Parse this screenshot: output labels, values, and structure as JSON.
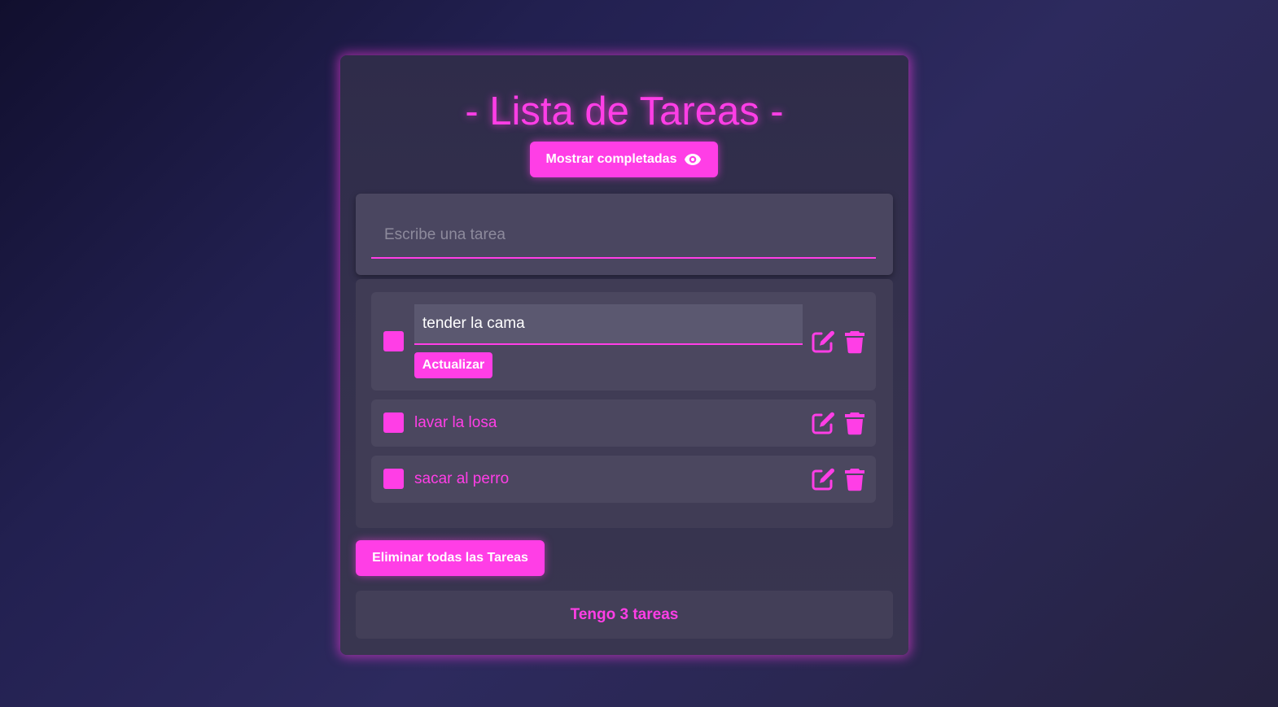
{
  "app": {
    "title": "- Lista de Tareas -",
    "accent_color": "#ff3ee6"
  },
  "header": {
    "show_completed_label": "Mostrar completadas",
    "show_completed_icon": "eye-icon"
  },
  "new_task": {
    "placeholder": "Escribe una tarea",
    "value": ""
  },
  "tasks": [
    {
      "text": "tender la cama",
      "editing": true,
      "completed": false,
      "update_label": "Actualizar",
      "edit_icon": "edit-icon",
      "delete_icon": "trash-icon"
    },
    {
      "text": "lavar la losa",
      "editing": false,
      "completed": false,
      "edit_icon": "edit-icon",
      "delete_icon": "trash-icon"
    },
    {
      "text": "sacar al perro",
      "editing": false,
      "completed": false,
      "edit_icon": "edit-icon",
      "delete_icon": "trash-icon"
    }
  ],
  "actions": {
    "delete_all_label": "Eliminar todas las Tareas"
  },
  "footer": {
    "counter_text": "Tengo 3 tareas"
  }
}
